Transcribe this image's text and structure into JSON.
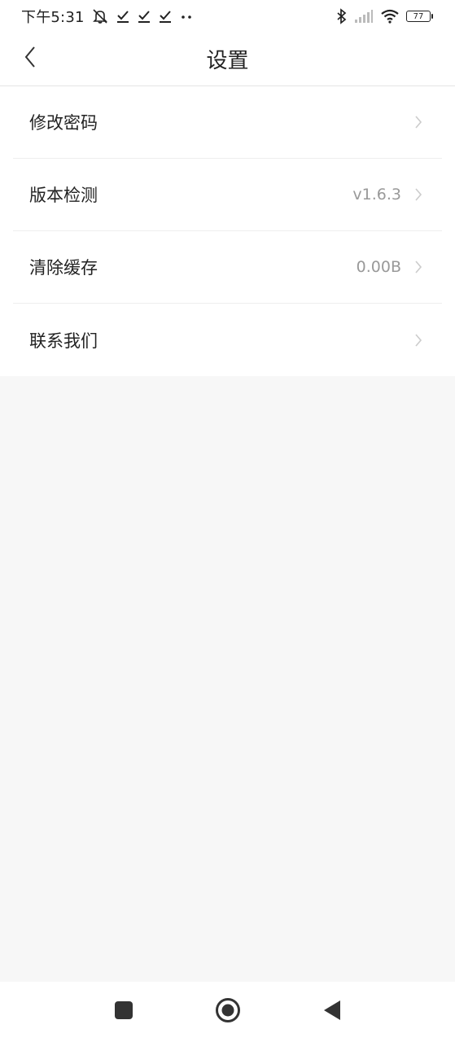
{
  "status_bar": {
    "time": "下午5:31",
    "battery_level": "77",
    "icons": [
      "mute-icon",
      "check-icon",
      "check-icon",
      "check-icon",
      "more-dots-icon",
      "bluetooth-icon",
      "signal-icon",
      "wifi-icon",
      "battery-icon"
    ]
  },
  "header": {
    "title": "设置",
    "back_icon": "chevron-left-icon"
  },
  "settings": {
    "items": [
      {
        "label": "修改密码",
        "value": ""
      },
      {
        "label": "版本检测",
        "value": "v1.6.3"
      },
      {
        "label": "清除缓存",
        "value": "0.00B"
      },
      {
        "label": "联系我们",
        "value": ""
      }
    ]
  },
  "nav_bar": {
    "icons": [
      "recent-apps-icon",
      "home-icon",
      "back-icon"
    ]
  },
  "colors": {
    "background": "#f7f7f7",
    "surface": "#ffffff",
    "text_primary": "#222222",
    "text_secondary": "#999999",
    "divider": "#eeeeee",
    "chevron": "#cccccc"
  }
}
